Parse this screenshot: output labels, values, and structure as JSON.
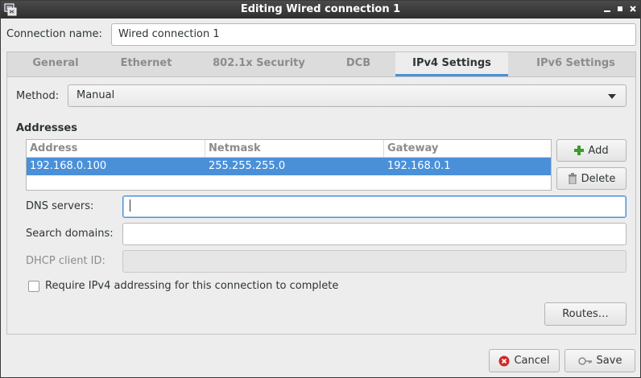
{
  "window": {
    "title": "Editing Wired connection 1"
  },
  "connection": {
    "label": "Connection name:",
    "value": "Wired connection 1"
  },
  "tabs": [
    {
      "label": "General",
      "active": false
    },
    {
      "label": "Ethernet",
      "active": false
    },
    {
      "label": "802.1x Security",
      "active": false
    },
    {
      "label": "DCB",
      "active": false
    },
    {
      "label": "IPv4 Settings",
      "active": true
    },
    {
      "label": "IPv6 Settings",
      "active": false
    }
  ],
  "method": {
    "label": "Method:",
    "value": "Manual"
  },
  "addresses": {
    "heading": "Addresses",
    "columns": [
      "Address",
      "Netmask",
      "Gateway"
    ],
    "rows": [
      {
        "address": "192.168.0.100",
        "netmask": "255.255.255.0",
        "gateway": "192.168.0.1"
      }
    ],
    "add_label": "Add",
    "delete_label": "Delete"
  },
  "fields": {
    "dns": {
      "label": "DNS servers:",
      "value": ""
    },
    "search": {
      "label": "Search domains:",
      "value": ""
    },
    "dhcp": {
      "label": "DHCP client ID:",
      "value": ""
    }
  },
  "require_ipv4": {
    "label": "Require IPv4 addressing for this connection to complete",
    "checked": false
  },
  "routes_label": "Routes…",
  "footer": {
    "cancel_label": "Cancel",
    "save_label": "Save"
  },
  "colors": {
    "accent": "#4a90d9",
    "titlebar": "#3a3a3a",
    "background": "#ededed"
  }
}
